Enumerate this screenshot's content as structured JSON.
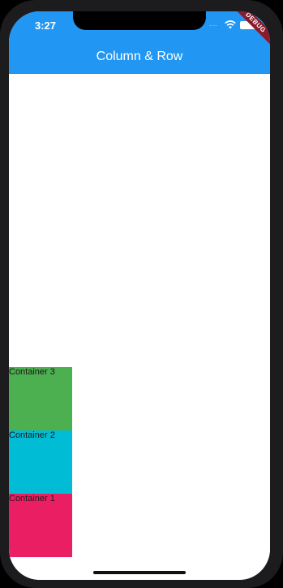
{
  "status_bar": {
    "time": "3:27",
    "signal_dots": "....",
    "wifi_icon": "wifi-icon",
    "battery_icon": "battery-icon"
  },
  "debug_banner": {
    "label": "DEBUG",
    "color": "#8b1a2b"
  },
  "app_bar": {
    "title": "Column & Row",
    "color": "#2196f3"
  },
  "containers": [
    {
      "label": "Container 3",
      "color": "#4caf50"
    },
    {
      "label": "Container 2",
      "color": "#00bcd4"
    },
    {
      "label": "Container 1",
      "color": "#e91e63"
    }
  ]
}
